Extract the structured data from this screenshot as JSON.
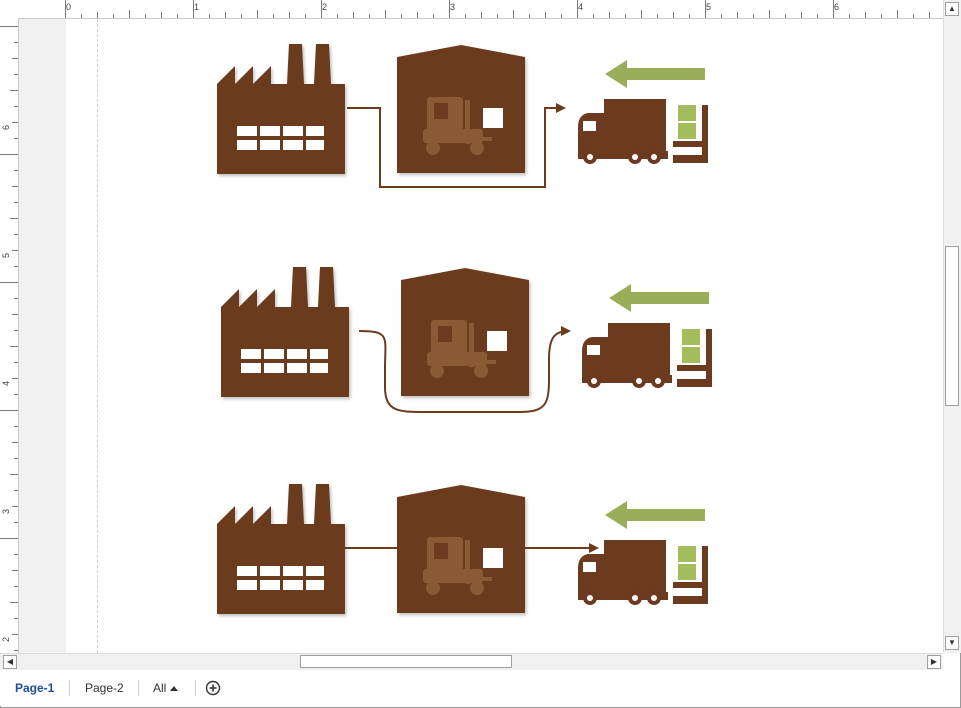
{
  "ruler": {
    "top_labels": [
      "0",
      "1",
      "2",
      "3",
      "4",
      "5",
      "6"
    ],
    "left_labels": [
      "6",
      "5",
      "4",
      "3",
      "2"
    ]
  },
  "tabs": {
    "page1": "Page-1",
    "page2": "Page-2",
    "all": "All"
  },
  "colors": {
    "brown": "#6b3a1f",
    "brown_light": "#8a5a34",
    "green": "#9aae5a",
    "green_box": "#a4bd5c"
  },
  "icons": [
    "factory-icon",
    "warehouse-icon",
    "forklift-icon",
    "truck-icon",
    "arrow-left-icon",
    "add-page-icon"
  ]
}
